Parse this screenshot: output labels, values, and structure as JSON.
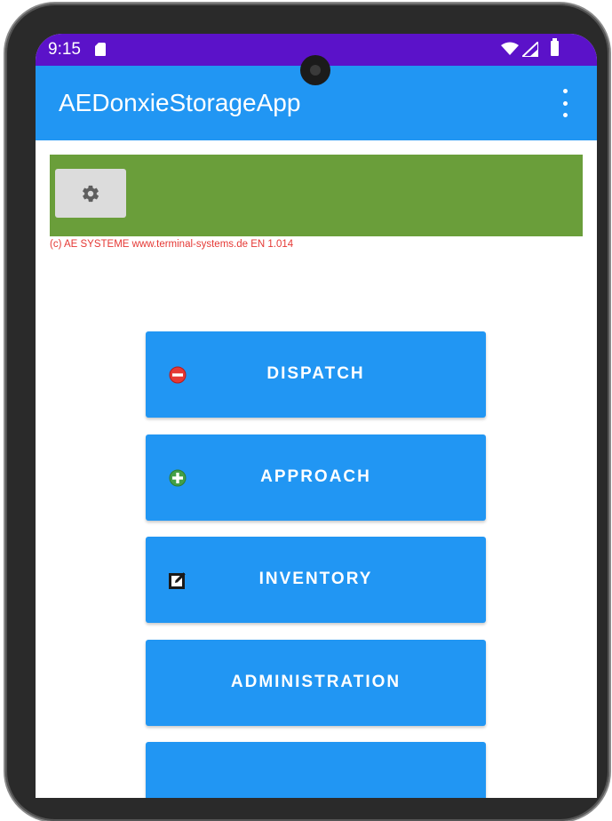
{
  "status_bar": {
    "time": "9:15",
    "background": "#5b12c9"
  },
  "app_bar": {
    "title": "AEDonxieStorageApp",
    "background": "#2196f3"
  },
  "header_panel": {
    "background": "#6a9e3a",
    "settings_icon": "gear-icon"
  },
  "copyright": "(c) AE SYSTEME www.terminal-systems.de EN 1.014",
  "menu": {
    "buttons": [
      {
        "label": "DISPATCH",
        "icon": "minus-circle-icon"
      },
      {
        "label": "APPROACH",
        "icon": "plus-circle-icon"
      },
      {
        "label": "INVENTORY",
        "icon": "edit-icon"
      },
      {
        "label": "ADMINISTRATION",
        "icon": ""
      },
      {
        "label": "",
        "icon": ""
      }
    ]
  },
  "colors": {
    "button": "#2196f3",
    "copyright_text": "#e53935",
    "dispatch_icon": "#e53935",
    "approach_icon": "#43a047"
  }
}
